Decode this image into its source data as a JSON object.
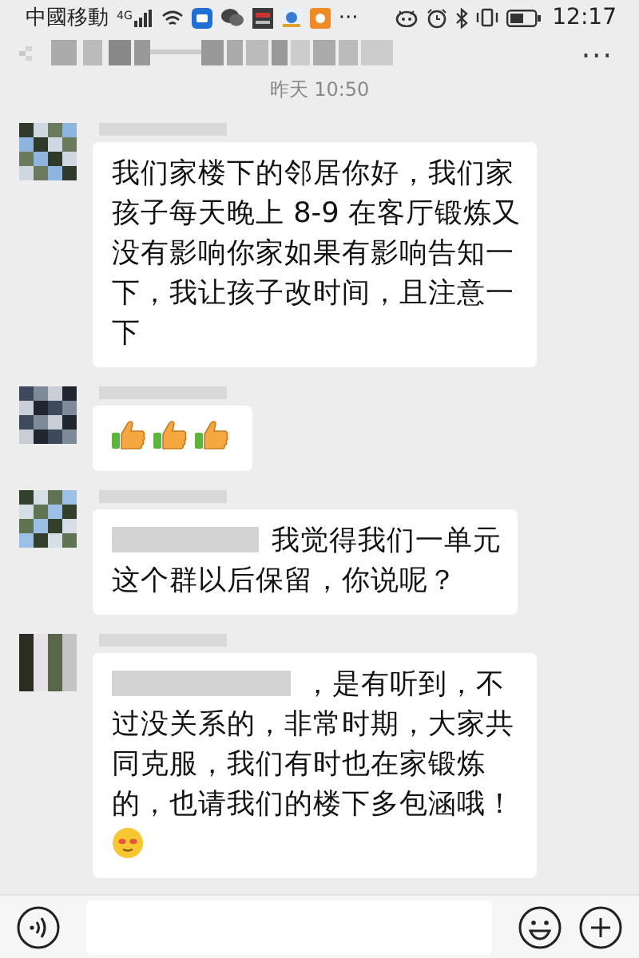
{
  "status_bar": {
    "carrier": "中國移動",
    "network": "4G",
    "more": "···",
    "time": "12:17"
  },
  "header": {
    "menu": "···"
  },
  "timestamp": "昨天 10:50",
  "messages": [
    {
      "parts": [
        {
          "kind": "text",
          "text": "我们家楼下的邻居你好，我们家孩子每天晚上 8-9 在客厅锻炼又没有影响你家如果有影响告知一下，我让孩子改时间，且注意一下"
        }
      ]
    },
    {
      "parts": [
        {
          "kind": "thumbs-up"
        },
        {
          "kind": "thumbs-up"
        },
        {
          "kind": "thumbs-up"
        }
      ]
    },
    {
      "parts": [
        {
          "kind": "redacted"
        },
        {
          "kind": "text",
          "text": "我觉得我们一单元"
        },
        {
          "kind": "text",
          "text": "这个群以后保留，你说呢？"
        }
      ]
    },
    {
      "parts": [
        {
          "kind": "redacted"
        },
        {
          "kind": "text",
          "text": "，是有听到，不"
        },
        {
          "kind": "text",
          "text": "过没关系的，非常时期，大家共同克服，我们有时也在家锻炼的，也请我们的楼下多包涵哦！"
        },
        {
          "kind": "blush"
        }
      ]
    }
  ]
}
